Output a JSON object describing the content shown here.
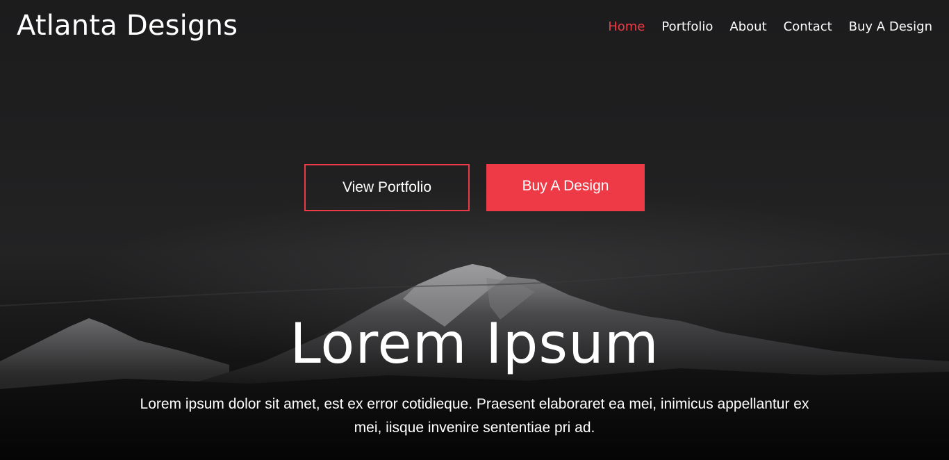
{
  "header": {
    "brand": "Atlanta Designs",
    "nav": [
      {
        "label": "Home",
        "active": true
      },
      {
        "label": "Portfolio",
        "active": false
      },
      {
        "label": "About",
        "active": false
      },
      {
        "label": "Contact",
        "active": false
      },
      {
        "label": "Buy A Design",
        "active": false
      }
    ]
  },
  "hero": {
    "primary_button": "View Portfolio",
    "secondary_button": "Buy A Design",
    "title": "Lorem Ipsum",
    "description": "Lorem ipsum dolor sit amet, est ex error cotidieque. Praesent elaboraret ea mei, inimicus appellantur ex mei, iisque invenire sententiae pri ad."
  },
  "colors": {
    "accent": "#ee3a46",
    "background": "#1c1c1d",
    "text": "#ffffff"
  }
}
